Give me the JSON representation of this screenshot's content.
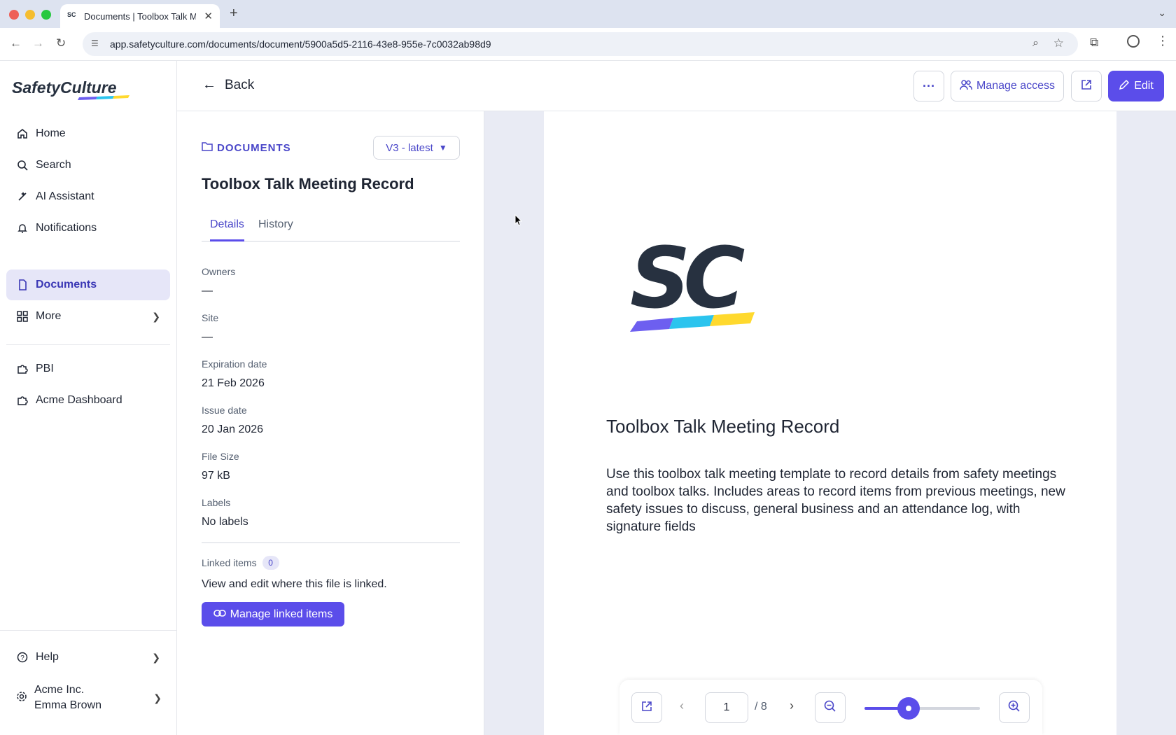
{
  "browser": {
    "tab_title": "Documents | Toolbox Talk Me",
    "url": "app.safetyculture.com/documents/document/5900a5d5-2116-43e8-955e-7c0032ab98d9"
  },
  "sidebar": {
    "logo_text": "SafetyCulture",
    "items": [
      {
        "label": "Home",
        "icon": "home-icon"
      },
      {
        "label": "Search",
        "icon": "search-icon"
      },
      {
        "label": "AI Assistant",
        "icon": "ai-sparkle-icon"
      },
      {
        "label": "Notifications",
        "icon": "bell-icon"
      },
      {
        "label": "Documents",
        "icon": "document-icon",
        "active": true
      },
      {
        "label": "More",
        "icon": "grid-icon"
      },
      {
        "label": "PBI",
        "icon": "puzzle-icon"
      },
      {
        "label": "Acme Dashboard",
        "icon": "puzzle-icon"
      }
    ],
    "help_label": "Help",
    "org_name": "Acme Inc.",
    "user_name": "Emma Brown"
  },
  "header": {
    "back_label": "Back",
    "manage_access_label": "Manage access",
    "edit_label": "Edit"
  },
  "details": {
    "breadcrumb": "DOCUMENTS",
    "version": "V3 - latest",
    "title": "Toolbox Talk Meeting Record",
    "tabs": [
      "Details",
      "History"
    ],
    "active_tab": "Details",
    "fields": {
      "owners_label": "Owners",
      "owners_value": "—",
      "site_label": "Site",
      "site_value": "—",
      "expiration_label": "Expiration date",
      "expiration_value": "21 Feb 2026",
      "issue_label": "Issue date",
      "issue_value": "20 Jan 2026",
      "size_label": "File Size",
      "size_value": "97 kB",
      "labels_label": "Labels",
      "labels_value": "No labels"
    },
    "linked_items_label": "Linked items",
    "linked_items_count": "0",
    "linked_items_desc": "View and edit where this file is linked.",
    "manage_linked_label": "Manage linked items"
  },
  "preview": {
    "title": "Toolbox Talk Meeting Record",
    "body": "Use this toolbox talk meeting template to record details from safety meetings and toolbox talks. Includes areas to record items from previous meetings, new safety issues to discuss, general business and an attendance log, with signature fields",
    "current_page": "1",
    "total_pages": "/ 8",
    "zoom_fraction": 0.38
  },
  "colors": {
    "accent": "#5b4dea",
    "accent_text": "#4a47c9",
    "active_bg": "#e6e6f8",
    "logo_dark": "#273140",
    "logo_purple": "#6d5ff0",
    "logo_cyan": "#2bc4ee",
    "logo_yellow": "#ffd92e"
  }
}
